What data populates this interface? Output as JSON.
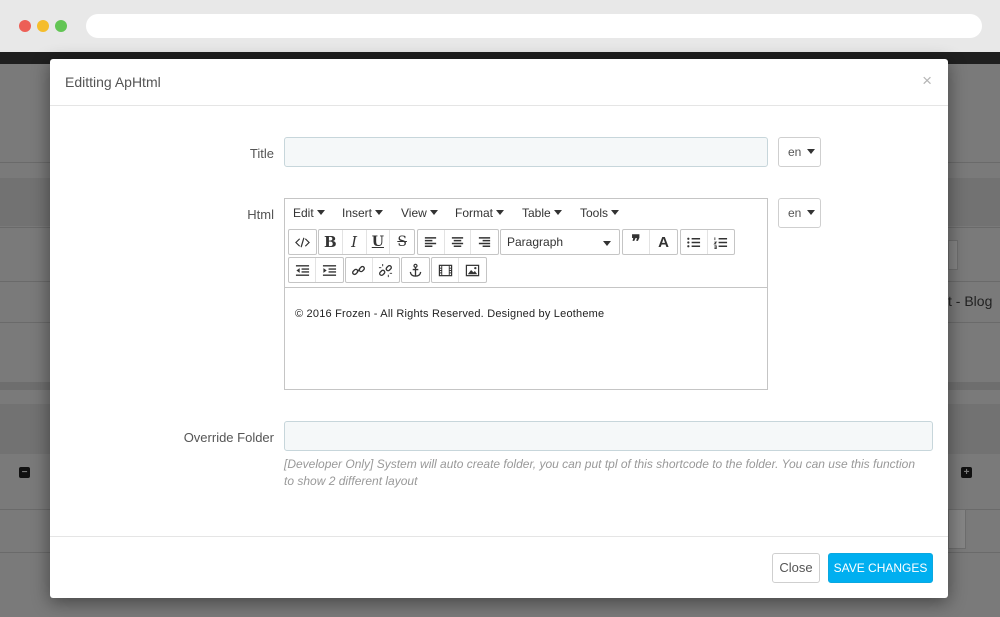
{
  "modal": {
    "title": "Editting ApHtml",
    "close_symbol": "×"
  },
  "background": {
    "right_text": "t - Blog"
  },
  "form": {
    "title_label": "Title",
    "title_value": "",
    "title_lang": "en",
    "html_label": "Html",
    "html_lang": "en",
    "override_label": "Override Folder",
    "override_value": "",
    "override_help": "[Developer Only] System will auto create folder, you can put tpl of this shortcode to the folder. You can use this function to show 2 different layout"
  },
  "editor": {
    "menus": [
      "Edit",
      "Insert",
      "View",
      "Format",
      "Table",
      "Tools"
    ],
    "block_format": "Paragraph",
    "content": "© 2016 Frozen - All Rights Reserved. Designed by Leotheme",
    "toolbar_icons": [
      "code-icon",
      "bold-icon",
      "italic-icon",
      "underline-icon",
      "strikethrough-icon",
      "align-left-icon",
      "align-center-icon",
      "align-right-icon",
      "blockquote-icon",
      "text-color-icon",
      "bullet-list-icon",
      "numbered-list-icon",
      "outdent-icon",
      "indent-icon",
      "link-icon",
      "unlink-icon",
      "anchor-icon",
      "media-icon",
      "image-icon"
    ],
    "glyphs": {
      "bold": "B",
      "italic": "I",
      "underline": "U",
      "strike": "S",
      "quote": "❞",
      "text_color": "A"
    }
  },
  "footer": {
    "close_label": "Close",
    "save_label": "SAVE CHANGES"
  },
  "colors": {
    "primary_button": "#00aff0",
    "input_background": "#f5f8f9",
    "input_border": "#c7d6db"
  }
}
